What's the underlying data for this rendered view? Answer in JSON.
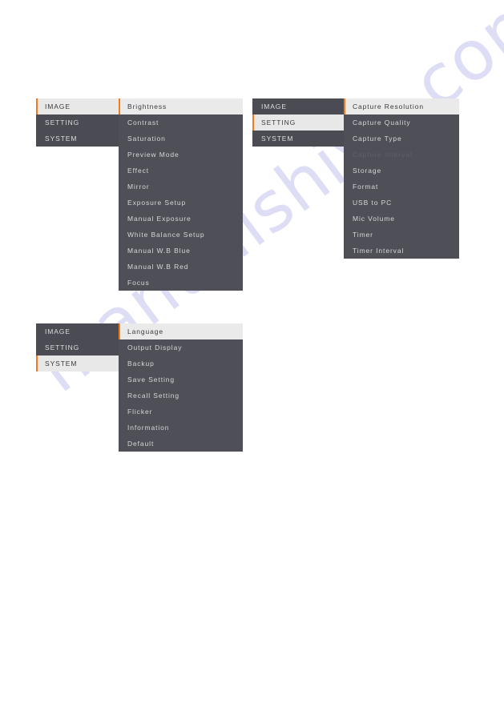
{
  "watermark": {
    "text": "manualshive.com"
  },
  "colors": {
    "accent": "#f07c1e",
    "panel_dark": "#4e4f57",
    "panel_left": "#4a4b53",
    "selected_bg": "#e8e8e8",
    "text": "#d6d7db",
    "text_disabled": "#5f6069",
    "text_selected": "#3b3b40"
  },
  "menus": [
    {
      "id": "menu-image",
      "name": "image-menu",
      "categories": [
        {
          "label": "IMAGE",
          "selected": true
        },
        {
          "label": "SETTING",
          "selected": false
        },
        {
          "label": "SYSTEM",
          "selected": false
        }
      ],
      "items": [
        {
          "label": "Brightness",
          "selected": true,
          "disabled": false
        },
        {
          "label": "Contrast",
          "selected": false,
          "disabled": false
        },
        {
          "label": "Saturation",
          "selected": false,
          "disabled": false
        },
        {
          "label": "Preview Mode",
          "selected": false,
          "disabled": false
        },
        {
          "label": "Effect",
          "selected": false,
          "disabled": false
        },
        {
          "label": "Mirror",
          "selected": false,
          "disabled": false
        },
        {
          "label": "Exposure Setup",
          "selected": false,
          "disabled": false
        },
        {
          "label": "Manual Exposure",
          "selected": false,
          "disabled": false
        },
        {
          "label": "White Balance Setup",
          "selected": false,
          "disabled": false
        },
        {
          "label": "Manual W.B Blue",
          "selected": false,
          "disabled": false
        },
        {
          "label": "Manual W.B Red",
          "selected": false,
          "disabled": false
        },
        {
          "label": "Focus",
          "selected": false,
          "disabled": false
        }
      ]
    },
    {
      "id": "menu-setting",
      "name": "setting-menu",
      "categories": [
        {
          "label": "IMAGE",
          "selected": false
        },
        {
          "label": "SETTING",
          "selected": true
        },
        {
          "label": "SYSTEM",
          "selected": false
        }
      ],
      "items": [
        {
          "label": "Capture Resolution",
          "selected": true,
          "disabled": false
        },
        {
          "label": "Capture Quality",
          "selected": false,
          "disabled": false
        },
        {
          "label": "Capture Type",
          "selected": false,
          "disabled": false
        },
        {
          "label": "Capture Interval",
          "selected": false,
          "disabled": true
        },
        {
          "label": "Storage",
          "selected": false,
          "disabled": false
        },
        {
          "label": "Format",
          "selected": false,
          "disabled": false
        },
        {
          "label": "USB to PC",
          "selected": false,
          "disabled": false
        },
        {
          "label": "Mic Volume",
          "selected": false,
          "disabled": false
        },
        {
          "label": "Timer",
          "selected": false,
          "disabled": false
        },
        {
          "label": "Timer Interval",
          "selected": false,
          "disabled": false
        }
      ]
    },
    {
      "id": "menu-system",
      "name": "system-menu",
      "categories": [
        {
          "label": "IMAGE",
          "selected": false
        },
        {
          "label": "SETTING",
          "selected": false
        },
        {
          "label": "SYSTEM",
          "selected": true
        }
      ],
      "items": [
        {
          "label": "Language",
          "selected": true,
          "disabled": false
        },
        {
          "label": "Output Display",
          "selected": false,
          "disabled": false
        },
        {
          "label": "Backup",
          "selected": false,
          "disabled": false
        },
        {
          "label": "Save Setting",
          "selected": false,
          "disabled": false
        },
        {
          "label": "Recall Setting",
          "selected": false,
          "disabled": false
        },
        {
          "label": "Flicker",
          "selected": false,
          "disabled": false
        },
        {
          "label": "Information",
          "selected": false,
          "disabled": false
        },
        {
          "label": "Default",
          "selected": false,
          "disabled": false
        }
      ]
    }
  ]
}
